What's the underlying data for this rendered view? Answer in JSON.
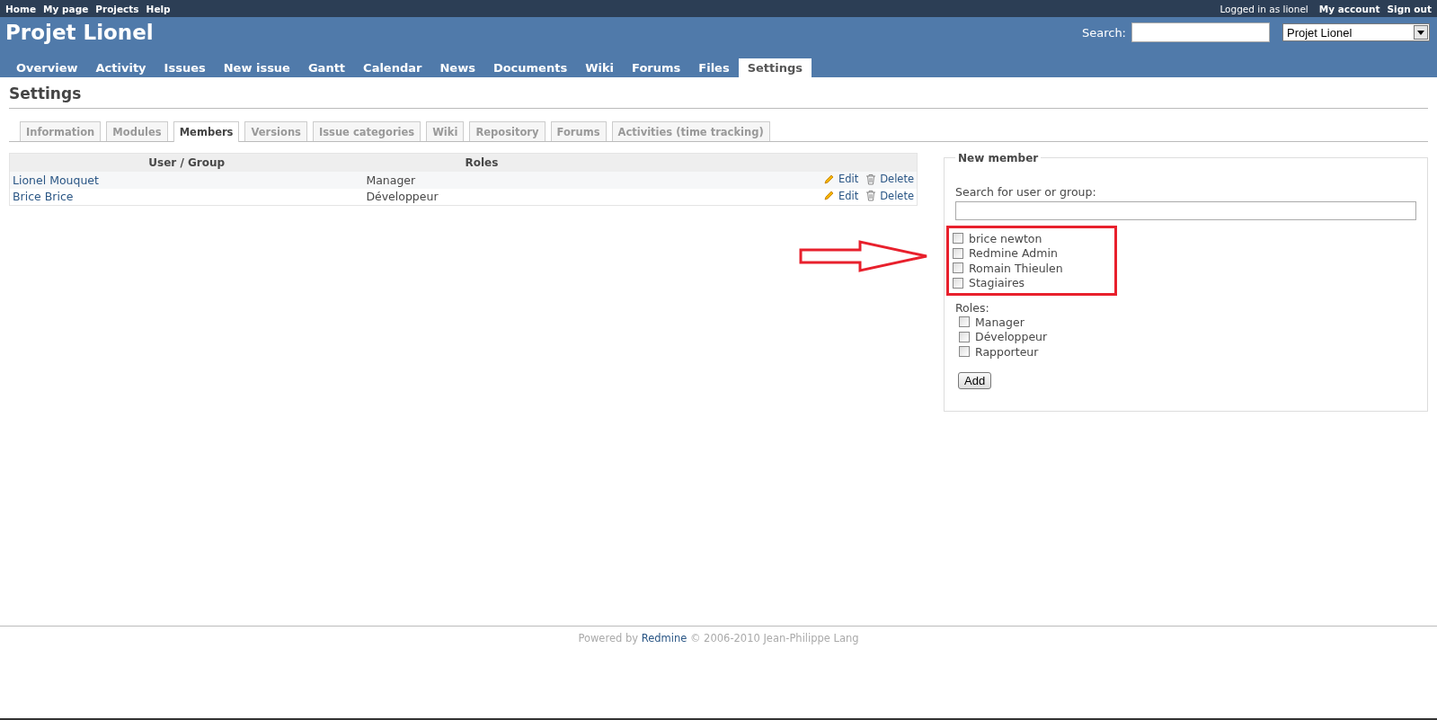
{
  "top_menu": {
    "left": [
      "Home",
      "My page",
      "Projects",
      "Help"
    ],
    "logged_in_prefix": "Logged in as",
    "logged_in_user": "lionel",
    "right": [
      "My account",
      "Sign out"
    ]
  },
  "header": {
    "title": "Projet Lionel",
    "search_label": "Search:",
    "project_select": "Projet Lionel"
  },
  "main_menu": [
    {
      "label": "Overview",
      "selected": false
    },
    {
      "label": "Activity",
      "selected": false
    },
    {
      "label": "Issues",
      "selected": false
    },
    {
      "label": "New issue",
      "selected": false
    },
    {
      "label": "Gantt",
      "selected": false
    },
    {
      "label": "Calendar",
      "selected": false
    },
    {
      "label": "News",
      "selected": false
    },
    {
      "label": "Documents",
      "selected": false
    },
    {
      "label": "Wiki",
      "selected": false
    },
    {
      "label": "Forums",
      "selected": false
    },
    {
      "label": "Files",
      "selected": false
    },
    {
      "label": "Settings",
      "selected": true
    }
  ],
  "page_title": "Settings",
  "settings_tabs": [
    {
      "label": "Information",
      "selected": false
    },
    {
      "label": "Modules",
      "selected": false
    },
    {
      "label": "Members",
      "selected": true
    },
    {
      "label": "Versions",
      "selected": false
    },
    {
      "label": "Issue categories",
      "selected": false
    },
    {
      "label": "Wiki",
      "selected": false
    },
    {
      "label": "Repository",
      "selected": false
    },
    {
      "label": "Forums",
      "selected": false
    },
    {
      "label": "Activities (time tracking)",
      "selected": false
    }
  ],
  "members_table": {
    "columns": [
      "User / Group",
      "Roles"
    ],
    "rows": [
      {
        "user": "Lionel Mouquet",
        "role": "Manager",
        "edit": "Edit",
        "delete": "Delete"
      },
      {
        "user": "Brice Brice",
        "role": "Développeur",
        "edit": "Edit",
        "delete": "Delete"
      }
    ]
  },
  "new_member": {
    "legend": "New member",
    "search_label": "Search for user or group:",
    "principals": [
      {
        "label": "brice newton",
        "checked": false
      },
      {
        "label": "Redmine Admin",
        "checked": false
      },
      {
        "label": "Romain Thieulen",
        "checked": false
      },
      {
        "label": "Stagiaires",
        "checked": false
      }
    ],
    "roles_label": "Roles:",
    "roles": [
      {
        "label": "Manager",
        "checked": false
      },
      {
        "label": "Développeur",
        "checked": false
      },
      {
        "label": "Rapporteur",
        "checked": false
      }
    ],
    "add_button": "Add"
  },
  "footer": {
    "before": "Powered by",
    "link": "Redmine",
    "after": "© 2006-2010 Jean-Philippe Lang"
  }
}
